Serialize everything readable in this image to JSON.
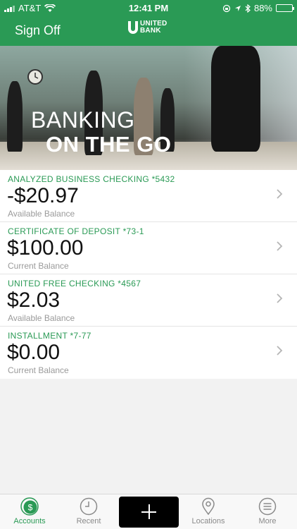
{
  "status_bar": {
    "carrier": "AT&T",
    "time": "12:41 PM",
    "battery": "88%",
    "battery_level": 0.88
  },
  "header": {
    "sign_off_label": "Sign Off",
    "logo_line1": "UNITED",
    "logo_line2": "BANK"
  },
  "hero": {
    "line1": "BANKING",
    "line2": "ON THE GO"
  },
  "accounts": [
    {
      "name": "ANALYZED BUSINESS CHECKING *5432",
      "amount": "-$20.97",
      "label": "Available Balance"
    },
    {
      "name": "CERTIFICATE OF DEPOSIT *73-1",
      "amount": "$100.00",
      "label": "Current Balance"
    },
    {
      "name": "UNITED FREE CHECKING *4567",
      "amount": "$2.03",
      "label": "Available Balance"
    },
    {
      "name": "INSTALLMENT *7-77",
      "amount": "$0.00",
      "label": "Current Balance"
    }
  ],
  "tab_bar": {
    "accounts": "Accounts",
    "recent": "Recent",
    "locations": "Locations",
    "more": "More"
  },
  "colors": {
    "brand_green": "#2a9a55",
    "label_gray": "#9a9a9a"
  }
}
